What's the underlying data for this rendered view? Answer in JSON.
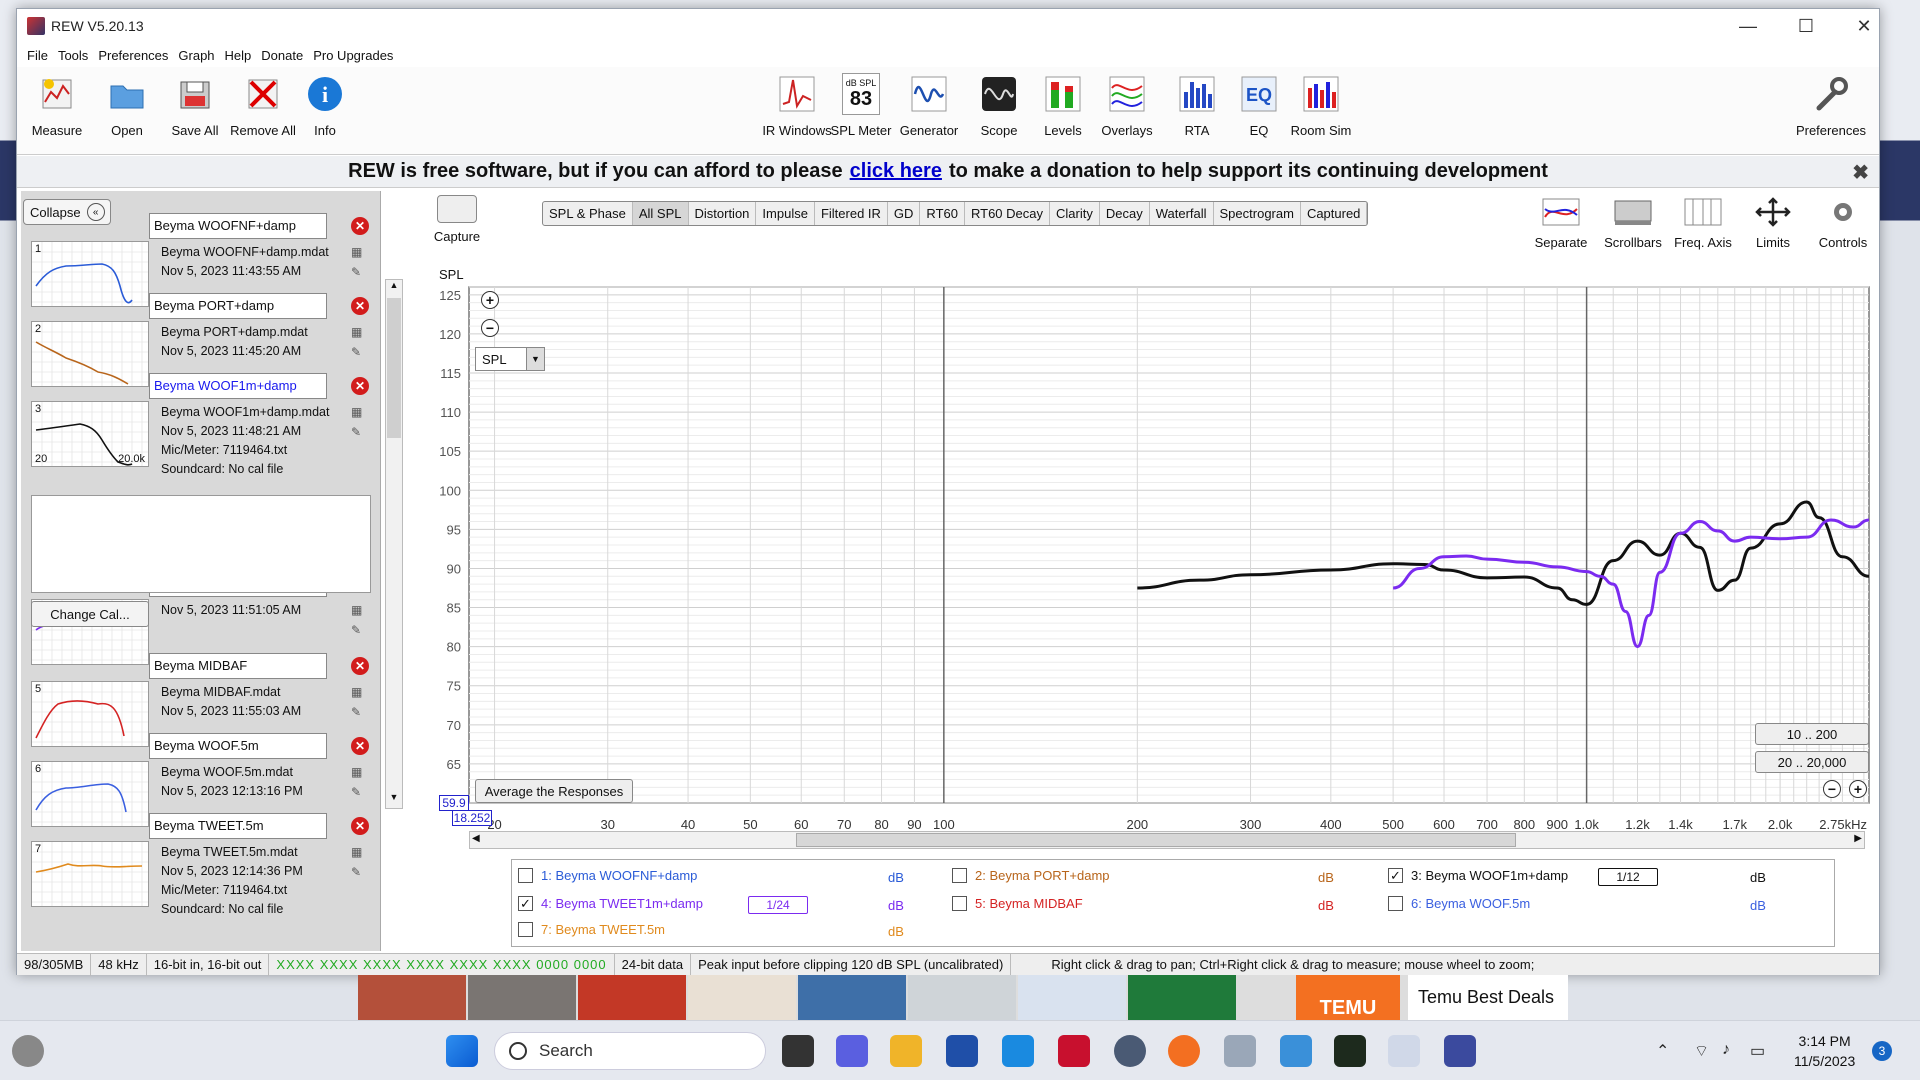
{
  "window": {
    "title": "REW V5.20.13",
    "minimize": "—",
    "maximize": "☐",
    "close": "✕"
  },
  "menu": [
    "File",
    "Tools",
    "Preferences",
    "Graph",
    "Help",
    "Donate",
    "Pro Upgrades"
  ],
  "toolbar_left": [
    {
      "label": "Measure",
      "icon": "measure-icon"
    },
    {
      "label": "Open",
      "icon": "folder-icon"
    },
    {
      "label": "Save All",
      "icon": "save-icon"
    },
    {
      "label": "Remove All",
      "icon": "remove-icon"
    },
    {
      "label": "Info",
      "icon": "info-icon"
    }
  ],
  "toolbar_right": [
    {
      "label": "IR Windows",
      "icon": "ir-windows-icon"
    },
    {
      "label": "SPL Meter",
      "icon": "spl-meter-icon",
      "small": "dB SPL",
      "value": "83"
    },
    {
      "label": "Generator",
      "icon": "generator-icon"
    },
    {
      "label": "Scope",
      "icon": "scope-icon"
    },
    {
      "label": "Levels",
      "icon": "levels-icon"
    },
    {
      "label": "Overlays",
      "icon": "overlays-icon"
    },
    {
      "label": "RTA",
      "icon": "rta-icon"
    },
    {
      "label": "EQ",
      "icon": "eq-icon"
    },
    {
      "label": "Room Sim",
      "icon": "room-sim-icon"
    }
  ],
  "preferences_label": "Preferences",
  "banner": {
    "before": "REW is free software, but if you can afford to please",
    "link": "click here",
    "after": "to make a donation to help support its continuing development",
    "close": "✖"
  },
  "left": {
    "collapse": "Collapse",
    "change_cal": "Change Cal...",
    "measurements": [
      {
        "num": "1",
        "name": "Beyma WOOFNF+damp",
        "file": "Beyma WOOFNF+damp.mdat",
        "date": "Nov 5, 2023 11:43:55 AM",
        "color": "#2a5bd7"
      },
      {
        "num": "2",
        "name": "Beyma PORT+damp",
        "file": "Beyma PORT+damp.mdat",
        "date": "Nov 5, 2023 11:45:20 AM",
        "color": "#b8651b"
      },
      {
        "num": "3",
        "name": "Beyma WOOF1m+damp",
        "file": "Beyma WOOF1m+damp.mdat",
        "date": "Nov 5, 2023 11:48:21 AM",
        "mic": "Mic/Meter: 7119464.txt",
        "sound": "Soundcard: No cal file",
        "color": "#111111",
        "thumb_left": "20",
        "thumb_right": "20.0k"
      },
      {
        "num": "4",
        "name": "Beyma TWEET1m+damp",
        "file": "",
        "date": "Nov 5, 2023 11:51:05 AM",
        "color": "#7b2bf0"
      },
      {
        "num": "5",
        "name": "Beyma MIDBAF",
        "file": "Beyma MIDBAF.mdat",
        "date": "Nov 5, 2023 11:55:03 AM",
        "color": "#d42323"
      },
      {
        "num": "6",
        "name": "Beyma WOOF.5m",
        "file": "Beyma WOOF.5m.mdat",
        "date": "Nov 5, 2023 12:13:16 PM",
        "color": "#3a5fe0"
      },
      {
        "num": "7",
        "name": "Beyma TWEET.5m",
        "file": "Beyma TWEET.5m.mdat",
        "date": "Nov 5, 2023 12:14:36 PM",
        "mic": "Mic/Meter: 7119464.txt",
        "sound": "Soundcard: No cal file",
        "color": "#e08a1d"
      }
    ]
  },
  "graph": {
    "capture": "Capture",
    "tabs": [
      "SPL & Phase",
      "All SPL",
      "Distortion",
      "Impulse",
      "Filtered IR",
      "GD",
      "RT60",
      "RT60 Decay",
      "Clarity",
      "Decay",
      "Waterfall",
      "Spectrogram",
      "Captured"
    ],
    "selected_tab": "All SPL",
    "controls": [
      {
        "label": "Separate",
        "icon": "separate-icon"
      },
      {
        "label": "Scrollbars",
        "icon": "scrollbars-icon"
      },
      {
        "label": "Freq. Axis",
        "icon": "freq-axis-icon"
      },
      {
        "label": "Limits",
        "icon": "limits-icon"
      },
      {
        "label": "Controls",
        "icon": "gear-icon"
      }
    ],
    "y_axis_label": "SPL",
    "dropdown": "SPL",
    "average": "Average the Responses",
    "range_buttons": [
      "10 .. 200",
      "20 .. 20,000"
    ],
    "cursor_y": "59.9",
    "cursor_x": "18.252",
    "legend": [
      {
        "label": "1: Beyma WOOFNF+damp",
        "checked": false,
        "color": "#2a5bd7",
        "unit": "dB"
      },
      {
        "label": "2: Beyma PORT+damp",
        "checked": false,
        "color": "#b8651b",
        "unit": "dB"
      },
      {
        "label": "3: Beyma WOOF1m+damp",
        "checked": true,
        "color": "#111111",
        "unit": "dB",
        "smoothing": "1/12"
      },
      {
        "label": "4: Beyma TWEET1m+damp",
        "checked": true,
        "color": "#7b2bf0",
        "unit": "dB",
        "smoothing": "1/24"
      },
      {
        "label": "5: Beyma MIDBAF",
        "checked": false,
        "color": "#d42323",
        "unit": "dB"
      },
      {
        "label": "6: Beyma WOOF.5m",
        "checked": false,
        "color": "#3a5fe0",
        "unit": "dB"
      },
      {
        "label": "7: Beyma TWEET.5m",
        "checked": false,
        "color": "#e08a1d",
        "unit": "dB"
      }
    ]
  },
  "chart_data": {
    "type": "line",
    "ylabel": "SPL",
    "y_ticks": [
      125,
      120,
      115,
      110,
      105,
      100,
      95,
      90,
      85,
      80,
      75,
      70,
      65
    ],
    "ylim": [
      60,
      126
    ],
    "x_scale": "log",
    "x_ticks": [
      "20",
      "30",
      "40",
      "50",
      "60",
      "70",
      "80",
      "90",
      "100",
      "200",
      "300",
      "400",
      "500",
      "600",
      "700",
      "800",
      "900",
      "1.0k",
      "1.2k",
      "1.4k",
      "1.7k",
      "2.0k",
      "2.75kHz"
    ],
    "xlim": [
      18.25,
      2750
    ],
    "grid": true,
    "series": [
      {
        "name": "3: Beyma WOOF1m+damp",
        "color": "#111111",
        "x": [
          200,
          250,
          300,
          400,
          500,
          560,
          600,
          700,
          800,
          900,
          950,
          1000,
          1100,
          1200,
          1300,
          1400,
          1500,
          1600,
          1700,
          1800,
          2000,
          2200,
          2300,
          2500,
          2750
        ],
        "y": [
          87.5,
          88.5,
          89.2,
          89.8,
          90.6,
          90.5,
          89.8,
          88.8,
          88.9,
          87.5,
          86,
          85.4,
          91,
          93.5,
          91.7,
          94.5,
          92.7,
          87.2,
          88.5,
          92.6,
          95.7,
          98.5,
          96.5,
          91.5,
          89
        ]
      },
      {
        "name": "4: Beyma TWEET1m+damp",
        "color": "#7b2bf0",
        "x": [
          500,
          550,
          600,
          650,
          700,
          800,
          900,
          1000,
          1050,
          1100,
          1150,
          1200,
          1250,
          1300,
          1400,
          1500,
          1600,
          1700,
          1800,
          2000,
          2200,
          2400,
          2600,
          2750
        ],
        "y": [
          87.5,
          90.0,
          91.5,
          91.6,
          91.2,
          90.8,
          90.2,
          89.6,
          89.0,
          88.0,
          84.5,
          80.0,
          84.0,
          89.5,
          94.5,
          96.0,
          94.8,
          93.5,
          94.0,
          93.8,
          94.0,
          96.2,
          95.3,
          96.2
        ]
      }
    ]
  },
  "status": {
    "mem": "98/305MB",
    "rate": "48 kHz",
    "bits": "16-bit in, 16-bit out",
    "levels": "XXXX XXXX  XXXX XXXX  XXXX XXXX  0000 0000",
    "data": "24-bit data",
    "peak": "Peak input before clipping 120 dB SPL (uncalibrated)",
    "hint": "Right click & drag to pan; Ctrl+Right click & drag to measure; mouse wheel to zoom;"
  },
  "ads": {
    "temu": "TEMU",
    "label": "Temu Best Deals"
  },
  "taskbar": {
    "search": "Search",
    "time": "3:14 PM",
    "date": "11/5/2023",
    "badge": "3"
  }
}
